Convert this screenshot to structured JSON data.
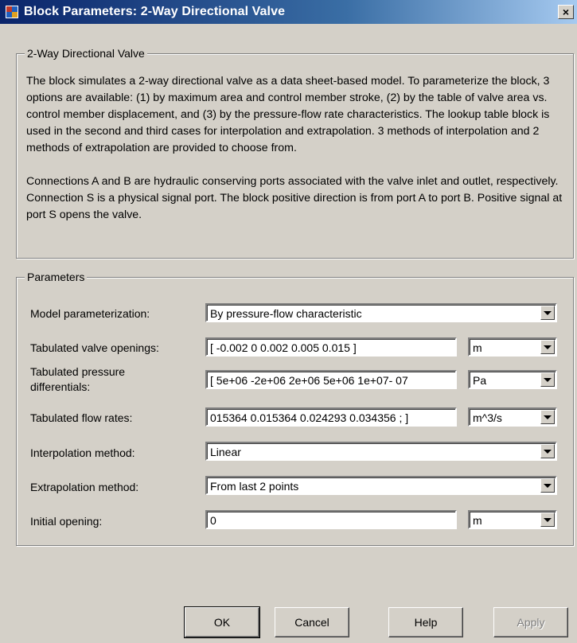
{
  "window": {
    "title": "Block Parameters: 2-Way Directional Valve",
    "close_label": "×"
  },
  "description_group": {
    "label": "2-Way Directional Valve",
    "paragraph1": "The block simulates a 2-way directional valve as a data sheet-based model. To parameterize the block, 3 options are available: (1) by maximum area and control member stroke, (2) by the table of valve area vs. control member displacement, and (3) by the pressure-flow rate characteristics. The lookup table block is used in the second and third cases for interpolation and extrapolation. 3 methods of interpolation and 2 methods of extrapolation are provided to choose from.",
    "paragraph2": "Connections A and B are hydraulic conserving ports associated with the valve inlet and outlet, respectively. Connection S is a physical signal port. The block positive direction is from port A to port B. Positive signal at port S opens the valve."
  },
  "parameters_group": {
    "label": "Parameters",
    "model_parameterization": {
      "label": "Model parameterization:",
      "value": "By pressure-flow characteristic"
    },
    "valve_openings": {
      "label": "Tabulated valve openings:",
      "value": "[ -0.002 0 0.002 0.005 0.015 ]",
      "unit": "m"
    },
    "pressure_differentials": {
      "label_line1": "Tabulated pressure",
      "label_line2": "differentials:",
      "value": "07 -5e+06 -2e+06 2e+06 5e+06 1e+07 ]",
      "unit": "Pa"
    },
    "flow_rates": {
      "label": "Tabulated flow rates:",
      "value": "015364 0.015364 0.024293 0.034356 ; ]",
      "unit": "m^3/s"
    },
    "interpolation": {
      "label": "Interpolation method:",
      "value": "Linear"
    },
    "extrapolation": {
      "label": "Extrapolation method:",
      "value": "From last 2 points"
    },
    "initial_opening": {
      "label": "Initial opening:",
      "value": "0",
      "unit": "m"
    }
  },
  "buttons": {
    "ok": "OK",
    "cancel": "Cancel",
    "help": "Help",
    "apply": "Apply"
  }
}
